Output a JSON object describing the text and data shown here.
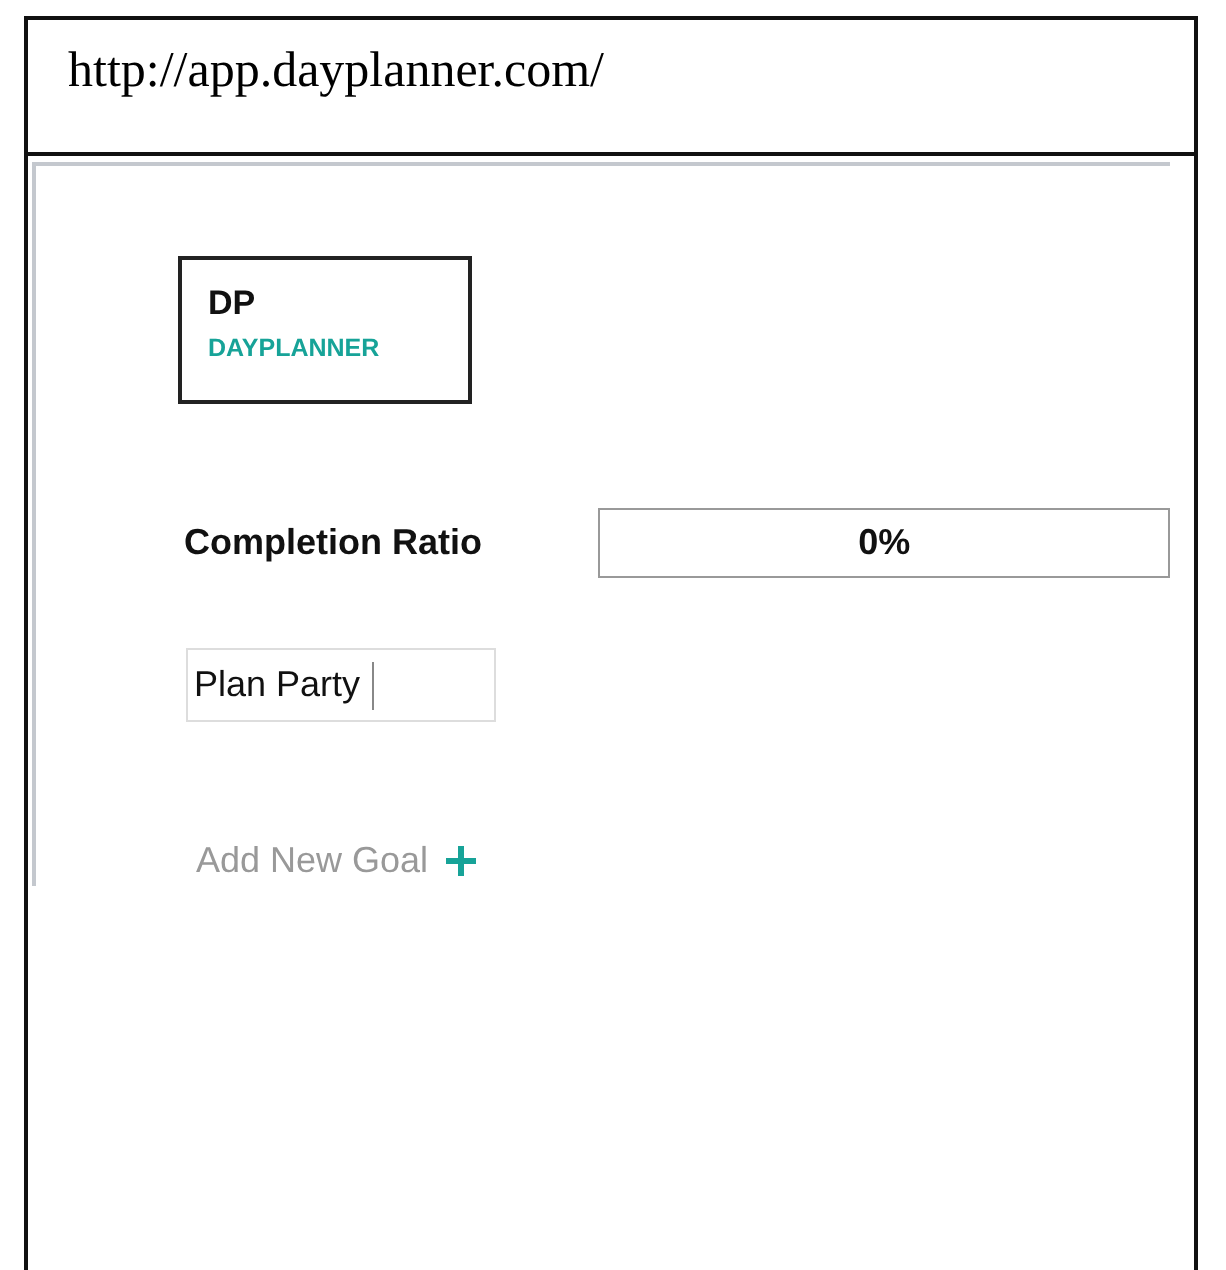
{
  "address_bar": {
    "url": "http://app.dayplanner.com/"
  },
  "logo": {
    "initials": "DP",
    "name": "DAYPLANNER"
  },
  "completion": {
    "label": "Completion Ratio",
    "level": 0,
    "reading": "0%"
  },
  "goals": [
    {
      "value": "Plan Party"
    }
  ],
  "add_goal": {
    "label": "Add New Goal"
  }
}
